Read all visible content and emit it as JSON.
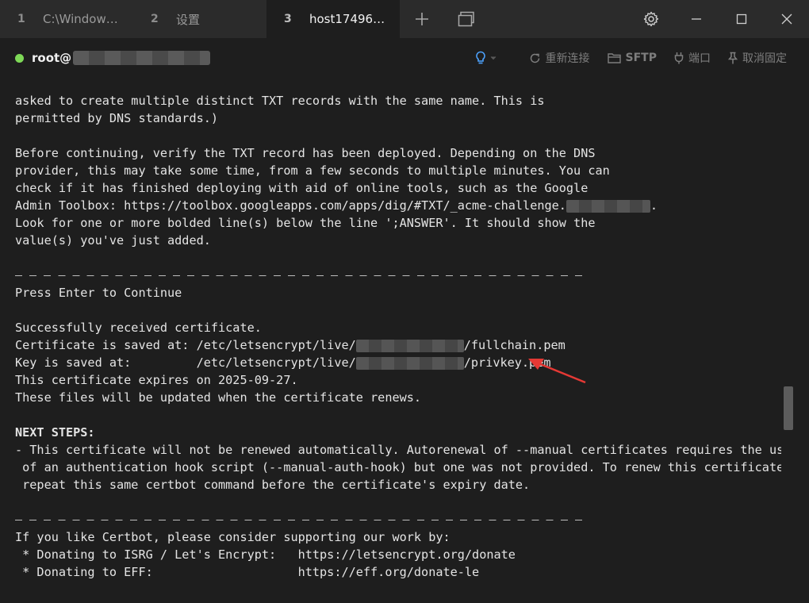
{
  "tabs": [
    {
      "num": "1",
      "title": "C:\\Window…"
    },
    {
      "num": "2",
      "title": "设置"
    },
    {
      "num": "3",
      "title": "host17496…"
    }
  ],
  "connection": {
    "status_color": "#7ed957",
    "user": "root@",
    "reconnect_label": "重新连接",
    "sftp_label": "SFTP",
    "port_label": "端口",
    "unpin_label": "取消固定"
  },
  "terminal": {
    "l01": "asked to create multiple distinct TXT records with the same name. This is",
    "l02": "permitted by DNS standards.)",
    "l04": "Before continuing, verify the TXT record has been deployed. Depending on the DNS",
    "l05": "provider, this may take some time, from a few seconds to multiple minutes. You can",
    "l06": "check if it has finished deploying with aid of online tools, such as the Google",
    "l07a": "Admin Toolbox: https://toolbox.googleapps.com/apps/dig/#TXT/_acme-challenge.",
    "l07b": ".",
    "l08": "Look for one or more bolded line(s) below the line ';ANSWER'. It should show the",
    "l09": "value(s) you've just added.",
    "l12": "Press Enter to Continue",
    "l14": "Successfully received certificate.",
    "l15a": "Certificate is saved at: /etc/letsencrypt/live/",
    "l15b": "/fullchain.pem",
    "l16a": "Key is saved at:         /etc/letsencrypt/live/",
    "l16b": "/privkey.pem",
    "l17": "This certificate expires on 2025-09-27.",
    "l18": "These files will be updated when the certificate renews.",
    "l20": "NEXT STEPS:",
    "l21": "- This certificate will not be renewed automatically. Autorenewal of --manual certificates requires the use",
    "l22": " of an authentication hook script (--manual-auth-hook) but one was not provided. To renew this certificate,",
    "l23": " repeat this same certbot command before the certificate's expiry date.",
    "l26": "If you like Certbot, please consider supporting our work by:",
    "l27": " * Donating to ISRG / Let's Encrypt:   https://letsencrypt.org/donate",
    "l28": " * Donating to EFF:                    https://eff.org/donate-le"
  },
  "annotation_color": "#e53935"
}
